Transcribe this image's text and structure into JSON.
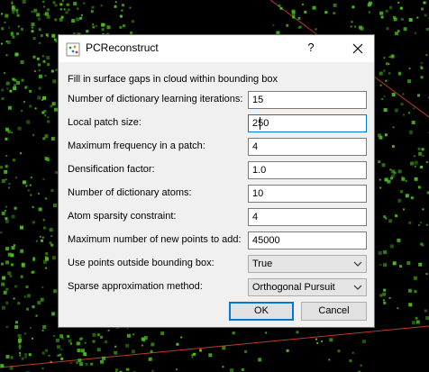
{
  "dialog": {
    "title": "PCReconstruct",
    "help_label": "?",
    "description": "Fill in surface gaps in cloud within bounding box"
  },
  "fields": [
    {
      "label": "Number of dictionary learning iterations:",
      "value": "15"
    },
    {
      "label": "Local patch size:",
      "value": "250"
    },
    {
      "label": "Maximum frequency in a patch:",
      "value": "4"
    },
    {
      "label": "Densification factor:",
      "value": "1.0"
    },
    {
      "label": "Number of dictionary atoms:",
      "value": "10"
    },
    {
      "label": "Atom sparsity constraint:",
      "value": "4"
    },
    {
      "label": "Maximum number of new points to add:",
      "value": "45000"
    },
    {
      "label": "Use points outside bounding box:",
      "value": "True"
    },
    {
      "label": "Sparse approximation method:",
      "value": "Orthogonal Pursuit"
    }
  ],
  "buttons": {
    "ok": "OK",
    "cancel": "Cancel"
  },
  "colors": {
    "accent": "#0078d7",
    "points": "#4fc21f",
    "background": "#000000",
    "bbox_line": "#c0392b"
  }
}
